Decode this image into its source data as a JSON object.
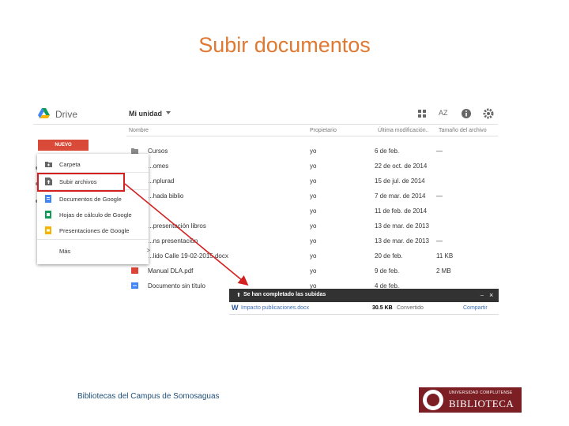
{
  "slide": {
    "title": "Subir documentos",
    "footer": "Bibliotecas del Campus de Somosaguas",
    "logo_line1": "UNIVERSIDAD COMPLUTENSE",
    "logo_line2": "BIBLIOTECA"
  },
  "drive": {
    "app_name": "Drive",
    "location": "Mi unidad",
    "new_button": "NUEVO",
    "columns": {
      "name": "Nombre",
      "owner": "Propietario",
      "modified": "Última modificación..",
      "size": "Tamaño del archivo",
      "sort_icon": "AZ"
    },
    "rows": [
      {
        "name": "Cursos",
        "owner": "yo",
        "date": "6 de feb.",
        "size": "—"
      },
      {
        "name": "...omes",
        "owner": "yo",
        "date": "22 de oct. de 2014",
        "size": ""
      },
      {
        "name": "...nplurad",
        "owner": "yo",
        "date": "15 de jul. de 2014",
        "size": ""
      },
      {
        "name": "...hada biblio",
        "owner": "yo",
        "date": "7 de mar. de 2014",
        "size": "—"
      },
      {
        "name": "",
        "owner": "yo",
        "date": "11 de feb. de 2014",
        "size": ""
      },
      {
        "name": "...presentación libros",
        "owner": "yo",
        "date": "13 de mar. de 2013",
        "size": ""
      },
      {
        "name": "...ns presentación",
        "owner": "yo",
        "date": "13 de mar. de 2013",
        "size": "—"
      },
      {
        "name": "...lido Calle 19-02-2015.docx",
        "owner": "yo",
        "date": "20 de feb.",
        "size": "11 KB"
      },
      {
        "name": "Manual DLA.pdf",
        "owner": "yo",
        "date": "9 de feb.",
        "size": "2 MB"
      },
      {
        "name": "Documento sin título",
        "owner": "yo",
        "date": "4 de feb.",
        "size": ""
      }
    ],
    "menu": {
      "folder": "Carpeta",
      "upload_files": "Subir archivos",
      "google_docs": "Documentos de Google",
      "google_sheets": "Hojas de cálculo de Google",
      "google_slides": "Presentaciones de Google",
      "more": "Más",
      "more_arrow": ">"
    },
    "colors": {
      "new_button": "#d94a38",
      "highlight": "#d32020",
      "folder": "#8a8a8a",
      "docs": "#4285f4",
      "sheets": "#0f9d58",
      "slides": "#f4b400",
      "pdf": "#db4437"
    }
  },
  "toast": {
    "title": "Se han completado las subidas",
    "close_glyph": "×",
    "minimize_glyph": "_",
    "file_name": "Impacto publicaciones.docx",
    "file_size": "30.5 KB",
    "status": "Convertido",
    "share": "Compartir",
    "file_badge": "W"
  }
}
